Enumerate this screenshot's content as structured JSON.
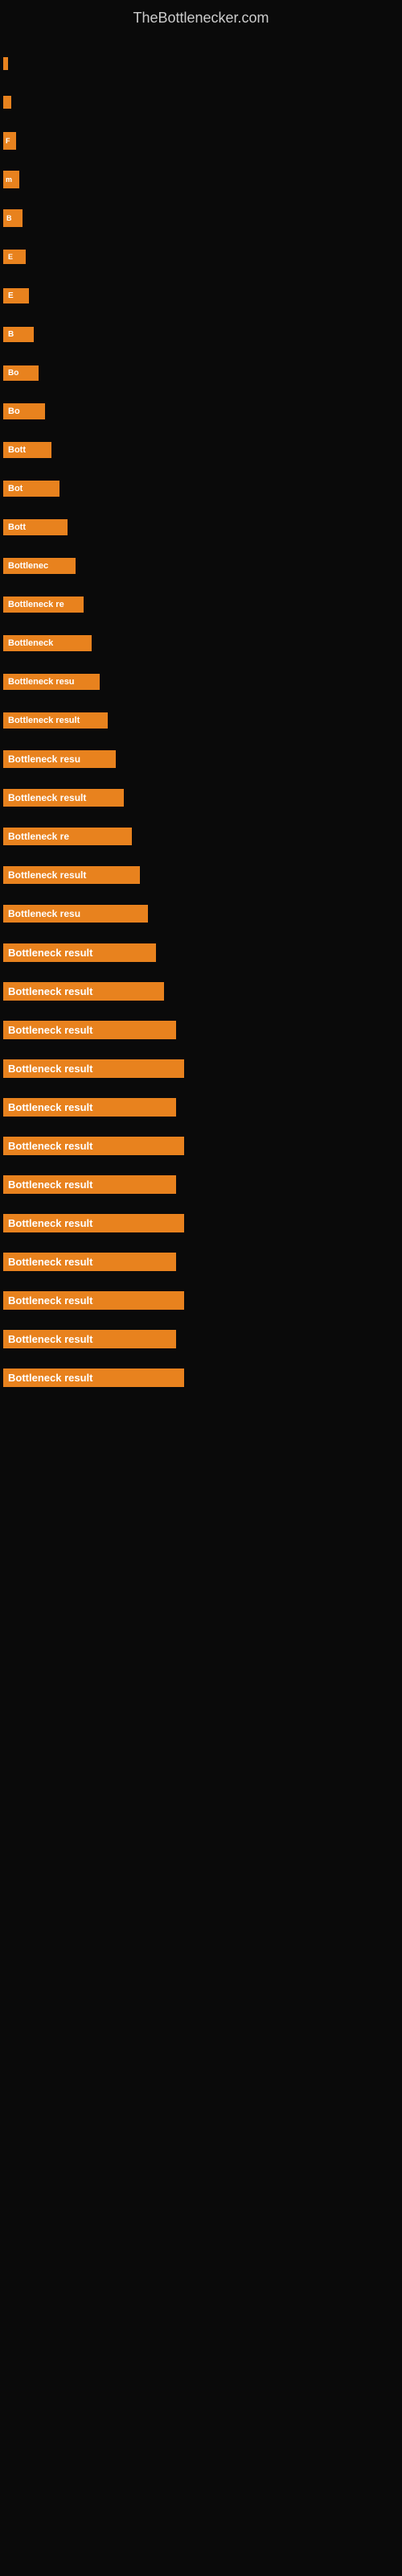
{
  "site": {
    "title": "TheBottlenecker.com"
  },
  "bars": [
    {
      "id": 1,
      "label": "",
      "size": "tiny",
      "text": ""
    },
    {
      "id": 2,
      "label": "",
      "size": "xs",
      "text": ""
    },
    {
      "id": 3,
      "label": "F",
      "size": "sm1",
      "text": "F"
    },
    {
      "id": 4,
      "label": "m",
      "size": "sm2",
      "text": "m"
    },
    {
      "id": 5,
      "label": "B",
      "size": "sm3",
      "text": "B"
    },
    {
      "id": 6,
      "label": "E",
      "size": "sm4",
      "text": "E"
    },
    {
      "id": 7,
      "label": "E",
      "size": "sm5",
      "text": "E"
    },
    {
      "id": 8,
      "label": "B",
      "size": "sm6",
      "text": "B"
    },
    {
      "id": 9,
      "label": "Bo",
      "size": "sm7",
      "text": "Bo"
    },
    {
      "id": 10,
      "label": "Bo",
      "size": "md1",
      "text": "Bo"
    },
    {
      "id": 11,
      "label": "Bott",
      "size": "md2",
      "text": "Bott"
    },
    {
      "id": 12,
      "label": "Bot",
      "size": "md3",
      "text": "Bot"
    },
    {
      "id": 13,
      "label": "Bott",
      "size": "md4",
      "text": "Bott"
    },
    {
      "id": 14,
      "label": "Bottlenec",
      "size": "md5",
      "text": "Bottlenec"
    },
    {
      "id": 15,
      "label": "Bottleneck re",
      "size": "md6",
      "text": "Bottleneck re"
    },
    {
      "id": 16,
      "label": "Bottleneck",
      "size": "md7",
      "text": "Bottleneck"
    },
    {
      "id": 17,
      "label": "Bottleneck resu",
      "size": "lg1",
      "text": "Bottleneck resu"
    },
    {
      "id": 18,
      "label": "Bottleneck result",
      "size": "lg2",
      "text": "Bottleneck result"
    },
    {
      "id": 19,
      "label": "Bottleneck resu",
      "size": "lg3",
      "text": "Bottleneck resu"
    },
    {
      "id": 20,
      "label": "Bottleneck result",
      "size": "lg4",
      "text": "Bottleneck result"
    },
    {
      "id": 21,
      "label": "Bottleneck re",
      "size": "lg5",
      "text": "Bottleneck re"
    },
    {
      "id": 22,
      "label": "Bottleneck result",
      "size": "lg6",
      "text": "Bottleneck result"
    },
    {
      "id": 23,
      "label": "Bottleneck resu",
      "size": "lg7",
      "text": "Bottleneck resu"
    },
    {
      "id": 24,
      "label": "Bottleneck result",
      "size": "xl1",
      "text": "Bottleneck result"
    },
    {
      "id": 25,
      "label": "Bottleneck result",
      "size": "xl2",
      "text": "Bottleneck result"
    },
    {
      "id": 26,
      "label": "Bottleneck result",
      "size": "xl3",
      "text": "Bottleneck result"
    },
    {
      "id": 27,
      "label": "Bottleneck result",
      "size": "xl4",
      "text": "Bottleneck result"
    },
    {
      "id": 28,
      "label": "Bottleneck result",
      "size": "xl3",
      "text": "Bottleneck result"
    },
    {
      "id": 29,
      "label": "Bottleneck result",
      "size": "xl4",
      "text": "Bottleneck result"
    },
    {
      "id": 30,
      "label": "Bottleneck result",
      "size": "xl3",
      "text": "Bottleneck result"
    },
    {
      "id": 31,
      "label": "Bottleneck result",
      "size": "xl4",
      "text": "Bottleneck result"
    },
    {
      "id": 32,
      "label": "Bottleneck result",
      "size": "xl3",
      "text": "Bottleneck result"
    },
    {
      "id": 33,
      "label": "Bottleneck result",
      "size": "xl4",
      "text": "Bottleneck result"
    },
    {
      "id": 34,
      "label": "Bottleneck result",
      "size": "xl3",
      "text": "Bottleneck result"
    },
    {
      "id": 35,
      "label": "Bottleneck result",
      "size": "xl4",
      "text": "Bottleneck result"
    }
  ],
  "colors": {
    "background": "#0a0a0a",
    "bar": "#e8821e",
    "title": "#cccccc"
  }
}
